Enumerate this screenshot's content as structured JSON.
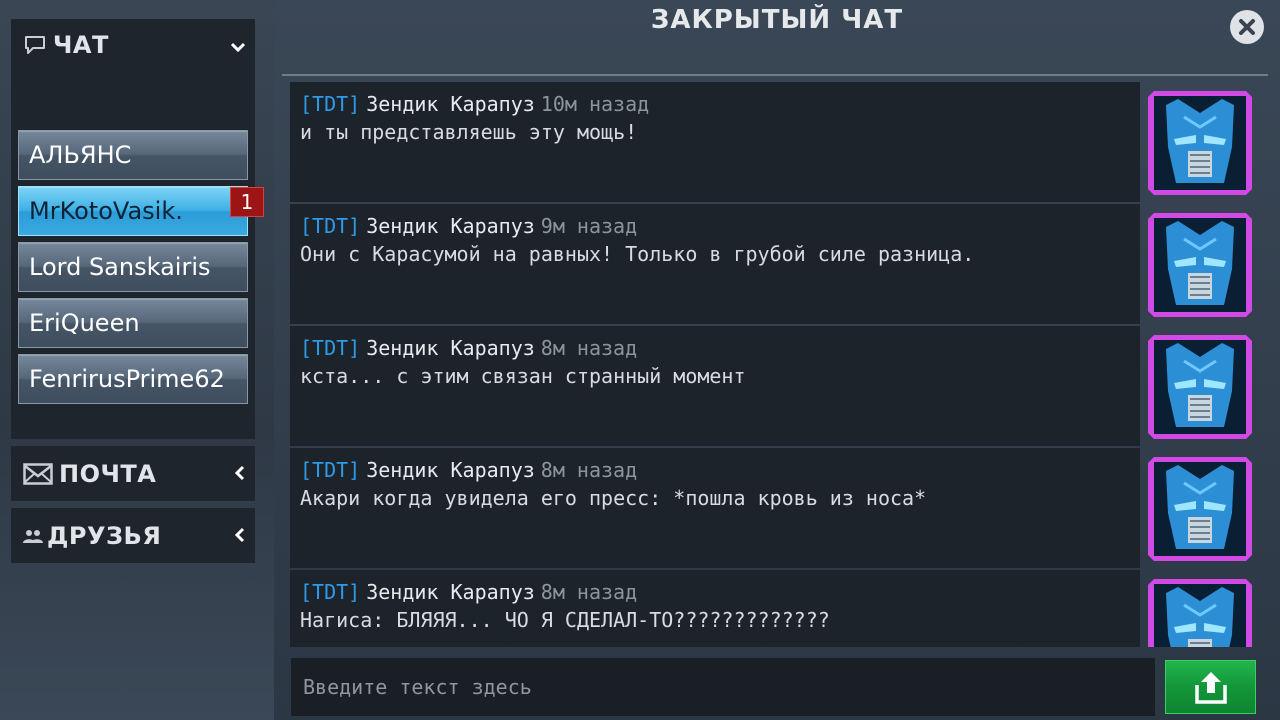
{
  "window": {
    "title": "ЗАКРЫТЫЙ ЧАТ"
  },
  "sidebar": {
    "chat": {
      "label": "ЧАТ",
      "icon": "chat-bubble-icon",
      "expanded": true,
      "items": [
        {
          "label": "АЛЬЯНС",
          "active": false
        },
        {
          "label": "MrKotoVasik.",
          "active": true,
          "badge": "1"
        },
        {
          "label": "Lord Sanskairis",
          "active": false
        },
        {
          "label": "EriQueen",
          "active": false
        },
        {
          "label": "FenrirusPrime62",
          "active": false
        }
      ]
    },
    "mail": {
      "label": "ПОЧТА",
      "icon": "envelope-icon",
      "expanded": false
    },
    "friends": {
      "label": "ДРУЗЬЯ",
      "icon": "people-icon",
      "expanded": false
    }
  },
  "messages": [
    {
      "tag": "[TDT]",
      "author": "Зендик Карапуз",
      "time": "10м назад",
      "text": "и ты представляешь эту мощь!"
    },
    {
      "tag": "[TDT]",
      "author": "Зендик Карапуз",
      "time": "9м назад",
      "text": "Они с Карасумой на равных! Только в грубой силе разница."
    },
    {
      "tag": "[TDT]",
      "author": "Зендик Карапуз",
      "time": "8м назад",
      "text": "кста... с этим связан странный момент"
    },
    {
      "tag": "[TDT]",
      "author": "Зендик Карапуз",
      "time": "8м назад",
      "text": "Акари когда увидела его пресс: *пошла кровь из носа*"
    },
    {
      "tag": "[TDT]",
      "author": "Зендик Карапуз",
      "time": "8м назад",
      "text": "Нагиса: БЛЯЯЯ... ЧО Я СДЕЛАЛ-ТО?????????????"
    }
  ],
  "composer": {
    "placeholder": "Введите текст здесь",
    "value": "",
    "send_icon": "send-upload-icon"
  },
  "colors": {
    "accent_blue": "#2e9be8",
    "active_tab": "#3fb0e6",
    "badge_red": "#9c1414",
    "send_green": "#13963a",
    "avatar_frame": "#d24ae6"
  }
}
